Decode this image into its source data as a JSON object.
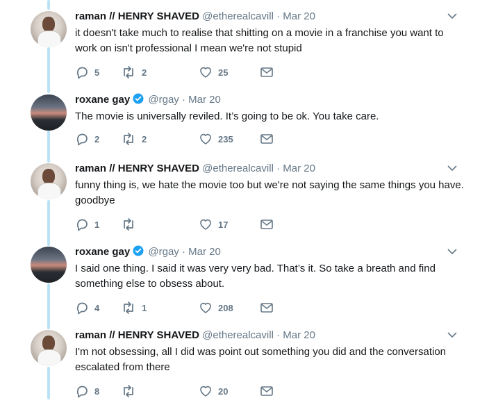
{
  "tweets": [
    {
      "avatar": "person-avatar",
      "name": "raman // HENRY SHAVED",
      "handle": "@etherealcavill",
      "sep": "·",
      "date": "Mar 20",
      "verified": false,
      "text": "it doesn't take much to realise that shitting on a movie in a franchise you want to work on isn't professional I mean we're not stupid",
      "replies": "5",
      "retweets": "2",
      "likes": "25"
    },
    {
      "avatar": "landscape-avatar",
      "name": "roxane gay",
      "handle": "@rgay",
      "sep": "·",
      "date": "Mar 20",
      "verified": true,
      "text": "The movie is universally reviled. It’s going to be ok. You take care.",
      "replies": "2",
      "retweets": "2",
      "likes": "235"
    },
    {
      "avatar": "person-avatar",
      "name": "raman // HENRY SHAVED",
      "handle": "@etherealcavill",
      "sep": "·",
      "date": "Mar 20",
      "verified": false,
      "text": "funny thing is, we hate the movie too but we're not saying the same things you have. goodbye",
      "replies": "1",
      "retweets": "",
      "likes": "17"
    },
    {
      "avatar": "landscape-avatar",
      "name": "roxane gay",
      "handle": "@rgay",
      "sep": "·",
      "date": "Mar 20",
      "verified": true,
      "text": "I said one thing. I said it was very very bad. That’s it. So take a breath and find something else to obsess about.",
      "replies": "4",
      "retweets": "1",
      "likes": "208"
    },
    {
      "avatar": "person-avatar",
      "name": "raman // HENRY SHAVED",
      "handle": "@etherealcavill",
      "sep": "·",
      "date": "Mar 20",
      "verified": false,
      "text": "I'm not obsessing, all I did was point out something you did and the conversation escalated from there",
      "replies": "8",
      "retweets": "",
      "likes": "20"
    }
  ],
  "colors": {
    "thread_line": "#b9e3f5",
    "verified": "#1da1f2",
    "muted": "#657786",
    "text": "#14171a"
  }
}
